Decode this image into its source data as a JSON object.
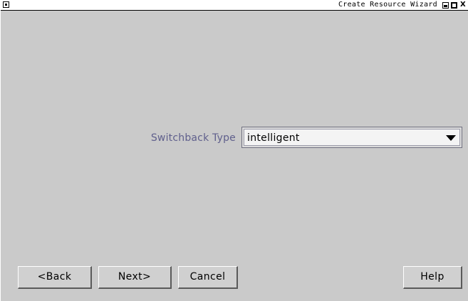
{
  "window": {
    "title": "Create Resource Wizard",
    "close_glyph": "X"
  },
  "form": {
    "switchback_label": "Switchback Type",
    "switchback_value": "intelligent"
  },
  "buttons": {
    "back": "<Back",
    "next": "Next>",
    "cancel": "Cancel",
    "help": "Help"
  },
  "icons": {
    "sysmenu": "window-menu-icon",
    "minimize": "minimize-icon",
    "maximize": "maximize-icon",
    "close": "close-icon",
    "dropdown": "dropdown-arrow-icon"
  },
  "colors": {
    "background": "#cacaca",
    "label": "#5f5f8c"
  }
}
